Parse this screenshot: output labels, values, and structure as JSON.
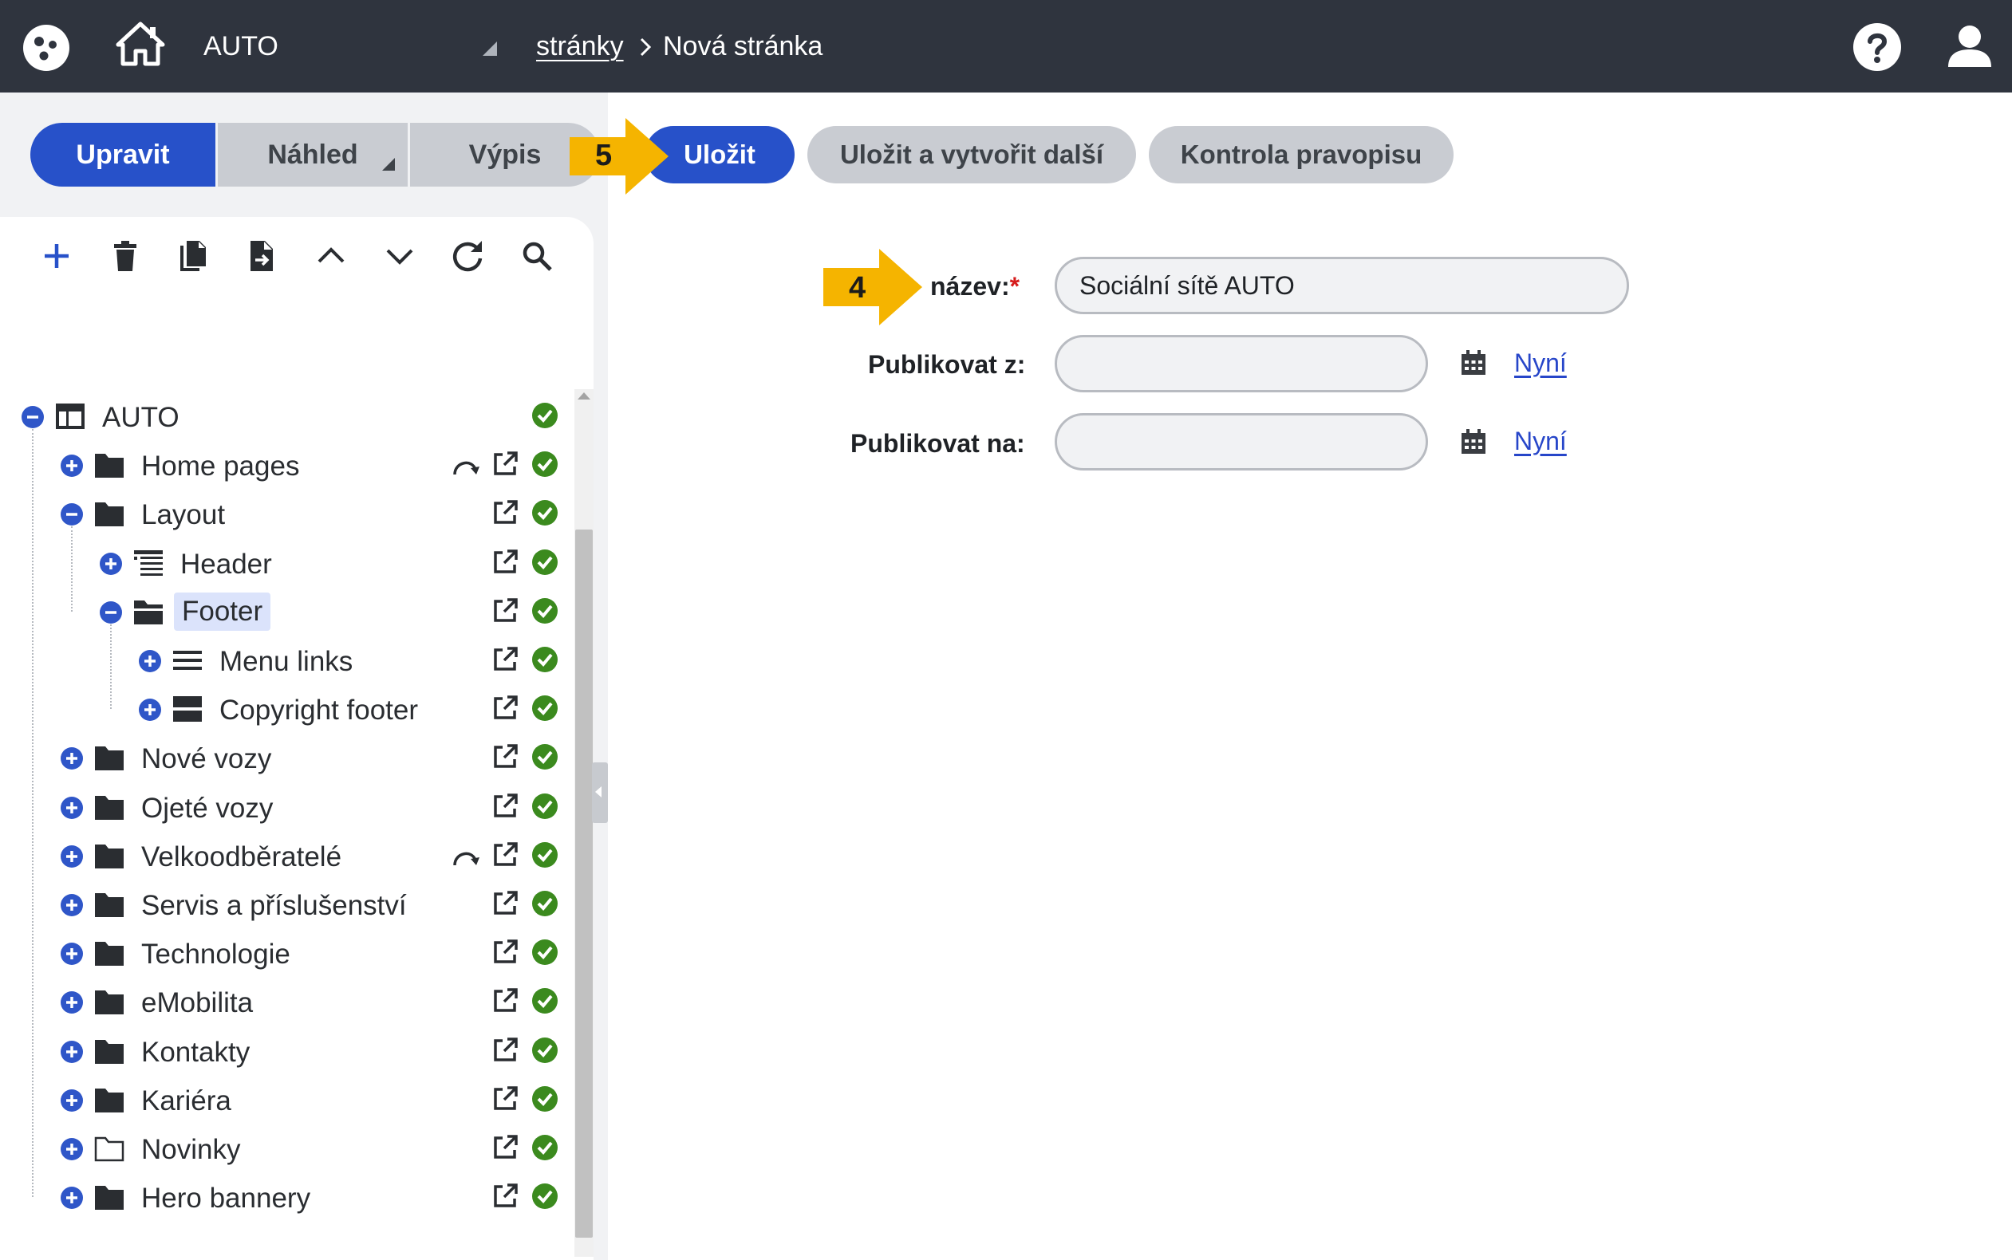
{
  "header": {
    "site_name": "AUTO",
    "breadcrumb_link": "stránky",
    "breadcrumb_current": "Nová stránka"
  },
  "tabs": [
    {
      "label": "Upravit",
      "active": true
    },
    {
      "label": "Náhled",
      "active": false
    },
    {
      "label": "Výpis",
      "active": false
    }
  ],
  "actions": {
    "save": "Uložit",
    "save_new": "Uložit a vytvořit další",
    "spellcheck": "Kontrola pravopisu"
  },
  "callouts": {
    "step_save": "5",
    "step_name": "4"
  },
  "form": {
    "name_label": "název:",
    "name_required": "*",
    "name_value": "Sociální sítě AUTO",
    "publish_from_label": "Publikovat z:",
    "publish_from_value": "",
    "publish_to_label": "Publikovat na:",
    "publish_to_value": "",
    "now_link": "Nyní"
  },
  "tree": [
    {
      "label": "AUTO",
      "level": 0,
      "toggle": "minus",
      "icon": "layout-icon",
      "redirect": false,
      "external": false
    },
    {
      "label": "Home pages",
      "level": 1,
      "toggle": "plus",
      "icon": "folder-icon",
      "redirect": true,
      "external": true
    },
    {
      "label": "Layout",
      "level": 1,
      "toggle": "minus",
      "icon": "folder-icon",
      "redirect": false,
      "external": true
    },
    {
      "label": "Header",
      "level": 2,
      "toggle": "plus",
      "icon": "header-icon",
      "redirect": false,
      "external": true
    },
    {
      "label": "Footer",
      "level": 2,
      "toggle": "minus",
      "icon": "folder-open-icon",
      "redirect": false,
      "external": true,
      "selected": true
    },
    {
      "label": "Menu links",
      "level": 3,
      "toggle": "plus",
      "icon": "menu-icon",
      "redirect": false,
      "external": true
    },
    {
      "label": "Copyright footer",
      "level": 3,
      "toggle": "plus",
      "icon": "block-icon",
      "redirect": false,
      "external": true
    },
    {
      "label": "Nové vozy",
      "level": 1,
      "toggle": "plus",
      "icon": "folder-icon",
      "redirect": false,
      "external": true
    },
    {
      "label": "Ojeté vozy",
      "level": 1,
      "toggle": "plus",
      "icon": "folder-icon",
      "redirect": false,
      "external": true
    },
    {
      "label": "Velkoodběratelé",
      "level": 1,
      "toggle": "plus",
      "icon": "folder-icon",
      "redirect": true,
      "external": true
    },
    {
      "label": "Servis a příslušenství",
      "level": 1,
      "toggle": "plus",
      "icon": "folder-icon",
      "redirect": false,
      "external": true
    },
    {
      "label": "Technologie",
      "level": 1,
      "toggle": "plus",
      "icon": "folder-icon",
      "redirect": false,
      "external": true
    },
    {
      "label": "eMobilita",
      "level": 1,
      "toggle": "plus",
      "icon": "folder-icon",
      "redirect": false,
      "external": true
    },
    {
      "label": "Kontakty",
      "level": 1,
      "toggle": "plus",
      "icon": "folder-icon",
      "redirect": false,
      "external": true
    },
    {
      "label": "Kariéra",
      "level": 1,
      "toggle": "plus",
      "icon": "folder-icon",
      "redirect": false,
      "external": true
    },
    {
      "label": "Novinky",
      "level": 1,
      "toggle": "plus",
      "icon": "folder-outline-icon",
      "redirect": false,
      "external": true
    },
    {
      "label": "Hero bannery",
      "level": 1,
      "toggle": "plus",
      "icon": "folder-icon",
      "redirect": false,
      "external": true
    }
  ],
  "colors": {
    "topbar": "#2f343e",
    "primary": "#2751c9",
    "secondary": "#c9ccd2",
    "callout": "#f5b400",
    "status_ok": "#3b8a1e",
    "toggle": "#2f56c8"
  }
}
